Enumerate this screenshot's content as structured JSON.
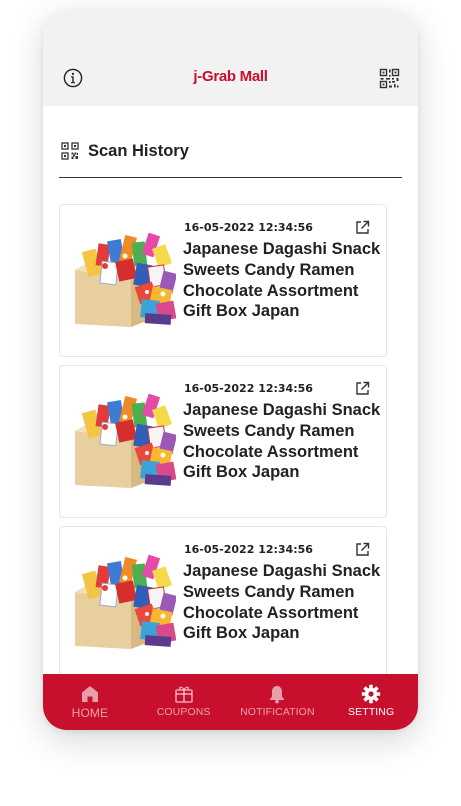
{
  "header": {
    "title": "j-Grab Mall"
  },
  "section": {
    "title": "Scan History"
  },
  "history": [
    {
      "date": "16-05-2022 12:34:56",
      "name": "Japanese Dagashi Snack Sweets Candy Ramen Chocolate Assortment Gift Box Japan"
    },
    {
      "date": "16-05-2022 12:34:56",
      "name": "Japanese Dagashi Snack Sweets Candy Ramen Chocolate Assortment Gift Box Japan"
    },
    {
      "date": "16-05-2022 12:34:56",
      "name": "Japanese Dagashi Snack Sweets Candy Ramen Chocolate Assortment Gift Box Japan"
    }
  ],
  "tabs": [
    {
      "label": "HOME",
      "icon": "home-icon"
    },
    {
      "label": "COUPONS",
      "icon": "gift-icon"
    },
    {
      "label": "NOTIFICATION",
      "icon": "bell-icon"
    },
    {
      "label": "SETTING",
      "icon": "gear-icon",
      "active": true
    }
  ],
  "colors": {
    "brand": "#c8102e",
    "header_bg": "#f2f2f2",
    "tab_inactive": "rgba(255,255,255,0.6)",
    "tab_active": "#ffffff"
  }
}
